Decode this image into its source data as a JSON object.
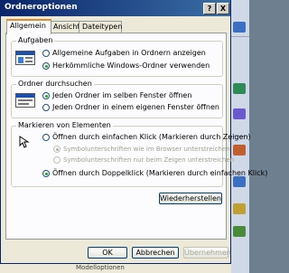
{
  "window": {
    "title": "Ordneroptionen",
    "help": "?",
    "close": "X"
  },
  "tabs": [
    {
      "label": "Allgemein",
      "active": true
    },
    {
      "label": "Ansicht",
      "active": false
    },
    {
      "label": "Dateitypen",
      "active": false
    }
  ],
  "groups": {
    "aufgaben": {
      "title": "Aufgaben",
      "options": [
        {
          "label": "Allgemeine Aufgaben in Ordnern anzeigen",
          "selected": false
        },
        {
          "label": "Herkömmliche Windows-Ordner verwenden",
          "selected": true
        }
      ]
    },
    "durchsuchen": {
      "title": "Ordner durchsuchen",
      "options": [
        {
          "label": "Jeden Ordner im selben Fenster öffnen",
          "selected": true
        },
        {
          "label": "Jeden Ordner in einem eigenen Fenster öffnen",
          "selected": false
        }
      ]
    },
    "markieren": {
      "title": "Markieren von Elementen",
      "options": [
        {
          "label": "Öffnen durch einfachen Klick (Markieren durch Zeigen)",
          "selected": false
        },
        {
          "label": "Symbolunterschriften wie im Browser unterstreichen",
          "selected": true,
          "disabled": true
        },
        {
          "label": "Symbolunterschriften nur beim Zeigen unterstreichen",
          "selected": false,
          "disabled": true
        },
        {
          "label": "Öffnen durch Doppelklick (Markieren durch einfachen Klick)",
          "selected": true
        }
      ]
    }
  },
  "buttons": {
    "restore": "Wiederherstellen",
    "ok": "OK",
    "cancel": "Abbrechen",
    "apply": "Übernehmen"
  },
  "status": {
    "text": "Modelloptionen"
  },
  "colors": {
    "titlebar": "#0a246a",
    "tab_highlight": "#e68b2c",
    "radio_dot": "#21a121"
  }
}
